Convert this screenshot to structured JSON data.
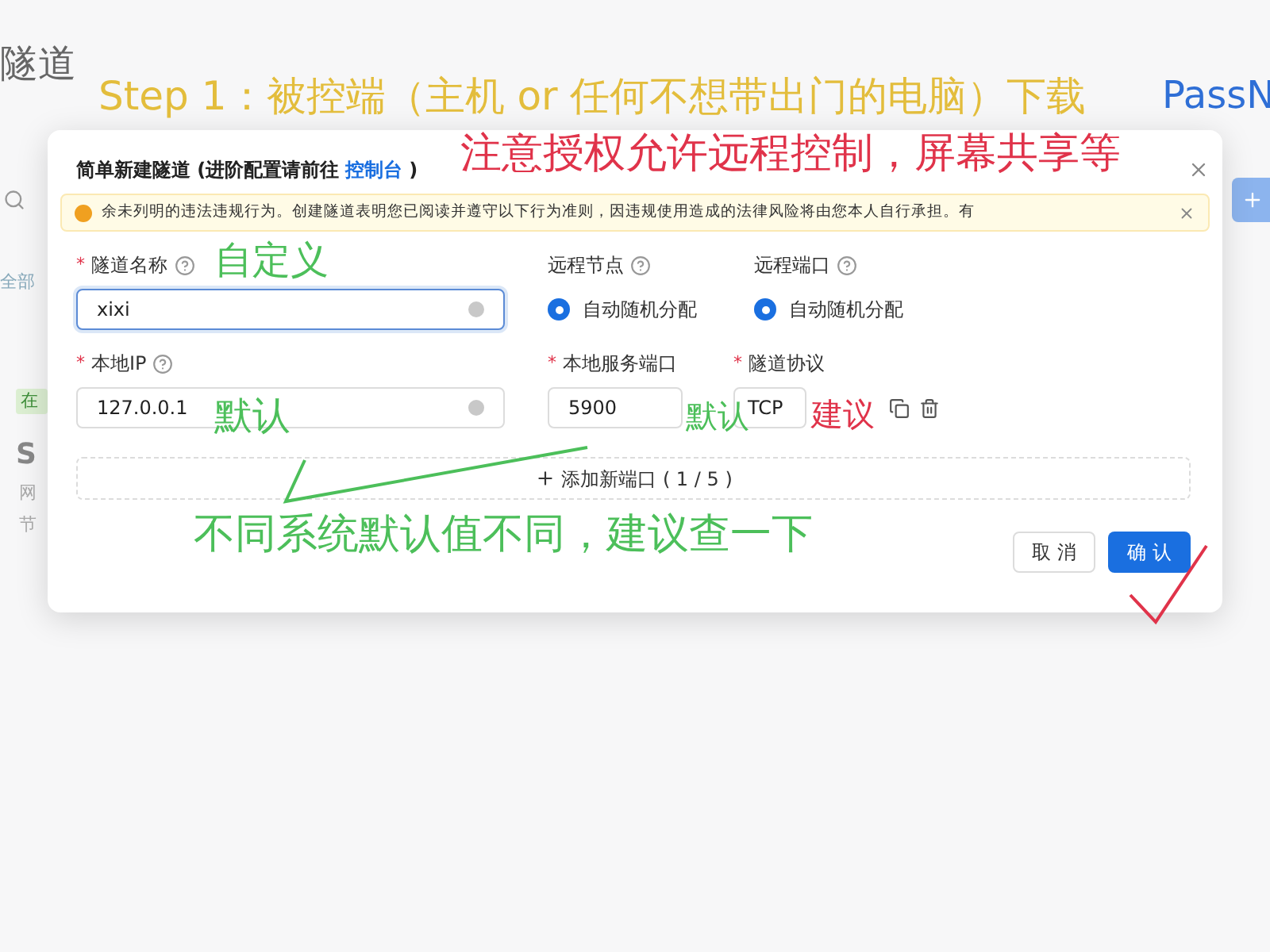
{
  "background": {
    "title": "隧道",
    "tab": "全部",
    "tag": "在",
    "card_title": "S",
    "card_lines": [
      "网",
      "节"
    ]
  },
  "dialog": {
    "title": "简单新建隧道 (进阶配置请前往",
    "link": "控制台",
    "title_end": ")",
    "alert": "余未列明的违法违规行为。创建隧道表明您已阅读并遵守以下行为准则，因违规使用造成的法律风险将由您本人自行承担。有",
    "fields": [
      {
        "label": "隧道名称",
        "required_mark": "*",
        "help": true,
        "kind": "input",
        "value": "xixi",
        "focused": true
      },
      {
        "label": "远程节点",
        "help": true,
        "kind": "radio",
        "value": "自动随机分配",
        "selected": true
      },
      {
        "label": "远程端口",
        "help": true,
        "kind": "radio",
        "value": "自动随机分配",
        "selected": true
      },
      {
        "label": "本地IP",
        "required_mark": "*",
        "help": true,
        "kind": "input",
        "value": "127.0.0.1",
        "focused": false
      },
      {
        "label": "本地服务端口",
        "required_mark": "*",
        "help": false,
        "kind": "port",
        "value": "5900"
      },
      {
        "label": "隧道协议",
        "required_mark": "*",
        "help": false,
        "kind": "select",
        "value": "TCP"
      }
    ],
    "add_button": "添加新端口 ( 1 / 5 )",
    "buttons": [
      {
        "label": "取 消",
        "primary": false
      },
      {
        "label": "确 认",
        "primary": true
      }
    ]
  },
  "annotations": [
    {
      "text": "Step 1：被控端（主机 or 任何不想带出门的电脑）下载",
      "color": "#e3bd3c"
    },
    {
      "text": "PassN",
      "color": "#2f6fd6"
    },
    {
      "text": "注意授权允许远程控制，屏幕共享等",
      "color": "#e0334a"
    },
    {
      "text": "自定义",
      "color": "#4cbf5a"
    },
    {
      "text": "默认",
      "color": "#4cbf5a"
    },
    {
      "text": "默认",
      "color": "#4cbf5a"
    },
    {
      "text": "建议",
      "color": "#e0334a"
    },
    {
      "text": "不同系统默认值不同，建议查一下",
      "color": "#4cbf5a"
    }
  ]
}
